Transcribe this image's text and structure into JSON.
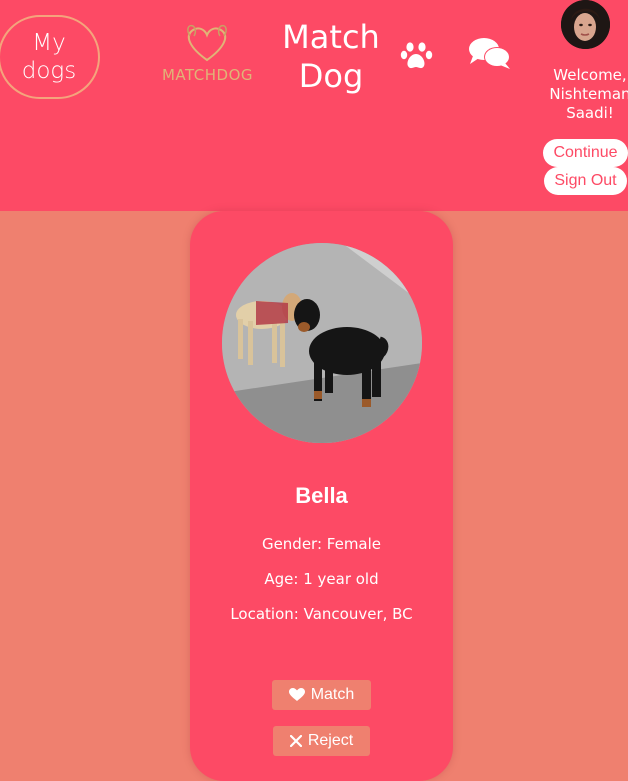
{
  "header": {
    "my_dogs_label": "My dogs",
    "logo_text": "MATCHDOG",
    "brand_title": "Match Dog",
    "paw_icon": "paw-icon",
    "chat_icon": "chat-bubbles-icon",
    "welcome_text": "Welcome, Nishteman Saadi!",
    "continue_label": "Continue",
    "signout_label": "Sign Out"
  },
  "card": {
    "dog_name": "Bella",
    "gender": "Gender: Female",
    "age": "Age: 1 year old",
    "location": "Location: Vancouver, BC",
    "match_label": "Match",
    "reject_label": "Reject",
    "match_icon": "heart-icon",
    "reject_icon": "close-icon"
  },
  "colors": {
    "header_bg": "#fd4a65",
    "page_bg": "#ef806f",
    "card_bg": "#fd4a65",
    "button_bg": "#ef806f",
    "logo_gold": "#e0b477"
  }
}
